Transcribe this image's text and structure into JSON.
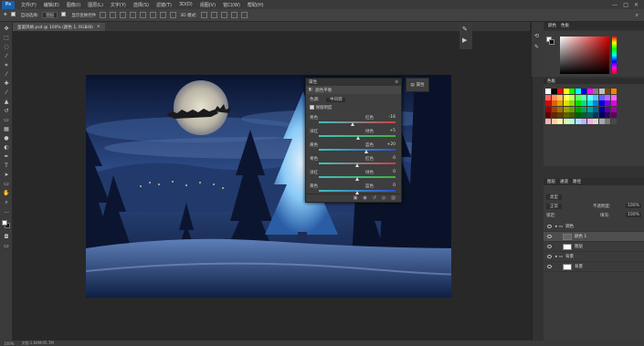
{
  "menu": {
    "logo": "Ps",
    "items": [
      "文件(F)",
      "编辑(E)",
      "图像(I)",
      "图层(L)",
      "文字(Y)",
      "选择(S)",
      "滤镜(T)",
      "3D(D)",
      "视图(V)",
      "窗口(W)",
      "帮助(H)"
    ],
    "window_controls": [
      "—",
      "□",
      "✕"
    ]
  },
  "options": {
    "auto_select_label": "自动选择:",
    "auto_select_value": "图层",
    "show_transform_label": "显示变换控件",
    "mode_3d": "3D 模式:"
  },
  "document": {
    "tab_title": "圣诞风格.psd @ 100% (颜色 1, RGB/8)",
    "close": "×"
  },
  "properties": {
    "panel_title": "属性",
    "tab_label": "调整",
    "adjust_title": "颜色平衡",
    "tone_label": "色调:",
    "tone_value": "中间调",
    "preserve_label": "保留明度",
    "rows": [
      {
        "left": "青色",
        "right": "红色",
        "value": "-16",
        "pos": 0.45,
        "color": "#d04040"
      },
      {
        "left": "洋红",
        "right": "绿色",
        "value": "+5",
        "pos": 0.52,
        "color": "#40b040"
      },
      {
        "left": "黄色",
        "right": "蓝色",
        "value": "+20",
        "pos": 0.62,
        "color": "#3050d0"
      }
    ],
    "rows2": [
      {
        "left": "青色",
        "right": "红色",
        "value": "0",
        "pos": 0.5,
        "color": "#d04040"
      },
      {
        "left": "洋红",
        "right": "绿色",
        "value": "0",
        "pos": 0.5,
        "color": "#40b040"
      },
      {
        "left": "黄色",
        "right": "蓝色",
        "value": "0",
        "pos": 0.5,
        "color": "#3050d0"
      }
    ],
    "footer_icons": [
      "clip-icon",
      "eye-icon",
      "reset-icon",
      "visibility-icon",
      "trash-icon"
    ]
  },
  "mini_panel": {
    "label": "属性"
  },
  "color_panel": {
    "tabs": [
      "颜色",
      "色板"
    ]
  },
  "swatches_panel": {
    "tabs": [
      "色板"
    ]
  },
  "swatch_colors": [
    "#ffffff",
    "#000000",
    "#ff0000",
    "#ffff00",
    "#00ff00",
    "#00ffff",
    "#0000ff",
    "#ff00ff",
    "#808080",
    "#c0c0c0",
    "#804000",
    "#ff8000",
    "#ff6060",
    "#ff9060",
    "#ffc060",
    "#ffff60",
    "#c0ff60",
    "#60ff60",
    "#60ffc0",
    "#60ffff",
    "#60c0ff",
    "#6060ff",
    "#c060ff",
    "#ff60ff",
    "#e00000",
    "#e06000",
    "#e0a000",
    "#e0e000",
    "#80e000",
    "#00e000",
    "#00e080",
    "#00e0e0",
    "#0080e0",
    "#0000e0",
    "#8000e0",
    "#e000e0",
    "#a00000",
    "#a04000",
    "#a07000",
    "#a0a000",
    "#60a000",
    "#00a000",
    "#00a060",
    "#00a0a0",
    "#0060a0",
    "#0000a0",
    "#6000a0",
    "#a000a0",
    "#600000",
    "#602800",
    "#604000",
    "#606000",
    "#386000",
    "#006000",
    "#006038",
    "#006060",
    "#003860",
    "#000060",
    "#380060",
    "#600060",
    "#ffb0b0",
    "#ffd0a0",
    "#fff0b0",
    "#d0ffb0",
    "#b0ffe0",
    "#b0e0ff",
    "#c0b0ff",
    "#ffb0e0",
    "#d8d8d8",
    "#a8a8a8",
    "#787878",
    "#484848"
  ],
  "layers": {
    "tabs": [
      "图层",
      "通道",
      "路径"
    ],
    "kind_label": "类型",
    "blend_mode": "正常",
    "opacity_label": "不透明度:",
    "opacity_value": "100%",
    "lock_label": "锁定:",
    "fill_label": "填充:",
    "fill_value": "100%",
    "items": [
      {
        "name": "调色",
        "type": "group"
      },
      {
        "name": "颜色 1",
        "type": "adjust"
      },
      {
        "name": "图层",
        "type": "layer"
      },
      {
        "name": "背景",
        "type": "group"
      },
      {
        "name": "背景",
        "type": "layer"
      }
    ]
  },
  "status": {
    "zoom": "100%",
    "doc_info": "文档:1.64M/45.7M"
  }
}
